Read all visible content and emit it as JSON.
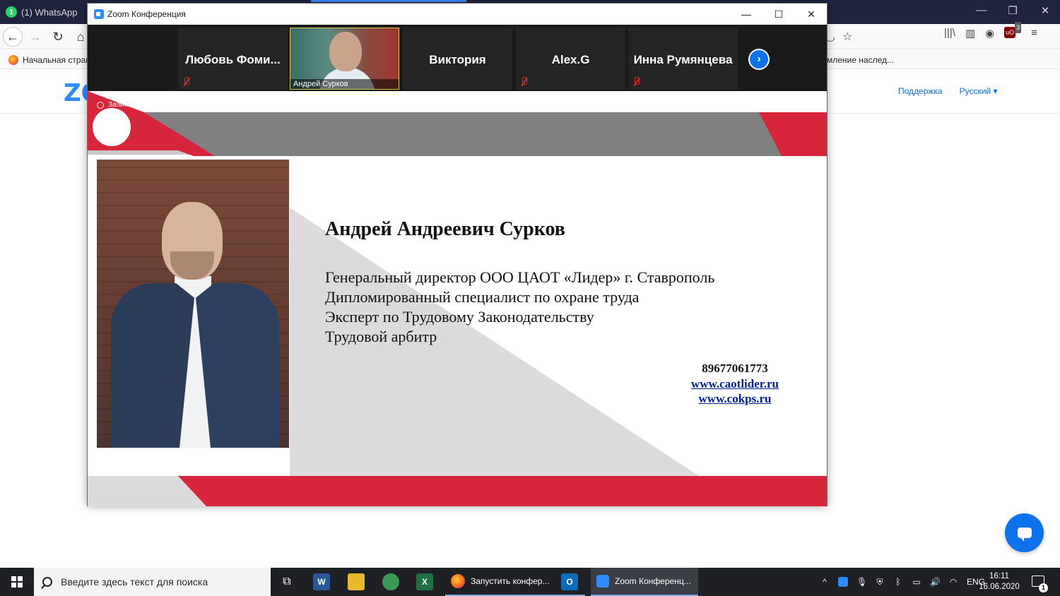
{
  "browser": {
    "tab": {
      "label": "(1) WhatsApp",
      "badge": "1"
    },
    "bookmarks": {
      "home": "Начальная стран",
      "right": "мление наслед..."
    },
    "page": {
      "logo_text": "ZO",
      "links": {
        "support": "Поддержка",
        "language": "Русский ▾"
      }
    },
    "extension_badge": "3"
  },
  "zoom": {
    "window_title": "Zoom Конференция",
    "participants": [
      {
        "name": "Любовь Фоми...",
        "muted": true
      },
      {
        "name": "Андрей Сурков",
        "muted": false,
        "video": true
      },
      {
        "name": "Виктория",
        "muted": false
      },
      {
        "name": "Alex.G",
        "muted": true
      },
      {
        "name": "Инна Румянцева",
        "muted": true
      }
    ],
    "recording_label": "Запись",
    "slide": {
      "name": "Андрей Андреевич Сурков",
      "roles": [
        "Генеральный директор ООО ЦАОТ «Лидер» г. Ставрополь",
        "Дипломированный специалист по охране труда",
        "Эксперт по Трудовому Законодательству",
        "Трудовой арбитр"
      ],
      "phone": "89677061773",
      "site1": "www.caotlider.ru",
      "site2": "www.cokps.ru"
    }
  },
  "taskbar": {
    "search_placeholder": "Введите здесь текст для поиска",
    "apps": [
      {
        "label": "Запустить конфер..."
      },
      {
        "label": "Zoom Конференц..."
      }
    ],
    "tray": {
      "lang": "ENG"
    },
    "clock": {
      "time": "16:11",
      "date": "16.06.2020"
    },
    "notifications": "1"
  },
  "colors": {
    "slide_red": "#d7253b",
    "slide_gray": "#808080",
    "zoom_blue": "#0e72ed",
    "taskbar": "#1e2024"
  }
}
